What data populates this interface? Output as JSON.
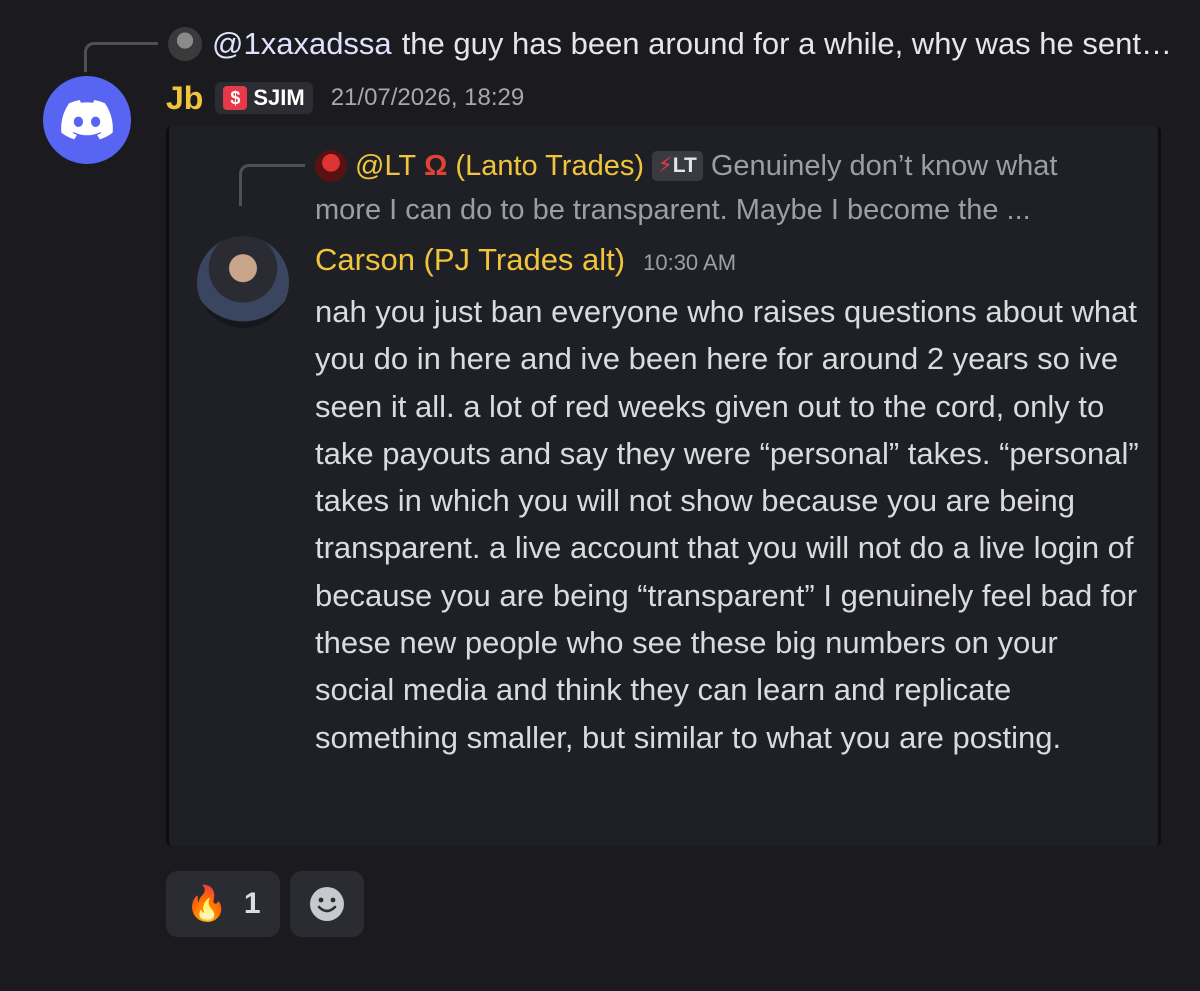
{
  "reply": {
    "mention": "@1xaxadssa",
    "text": "the guy has been around for a while, why was he sent to g..."
  },
  "message": {
    "author": "Jb",
    "role_tag": "SJIM",
    "timestamp": "21/07/2026, 18:29"
  },
  "embed": {
    "reply_mention": "@LT",
    "reply_name": "(Lanto Trades)",
    "reply_tag": "LT",
    "reply_line1": "Genuinely don’t know what",
    "reply_line2": "more I can do to be transparent.  Maybe I become the ...",
    "author": "Carson (PJ Trades alt)",
    "time": "10:30 AM",
    "body": "nah you just ban everyone who raises questions about what you do in here and ive been here for around 2 years so ive seen it all. a lot of red weeks given out to the cord, only to take payouts and say they were “personal” takes. “personal” takes in which you will not show because you are being transparent. a live account that you will not do a live login of because you are being “transparent” I genuinely feel bad for these new people who see these big numbers on your social media and think they can learn and replicate something smaller, but similar to what you are posting."
  },
  "reactions": [
    {
      "emoji": "🔥",
      "count": "1"
    }
  ],
  "colors": {
    "background": "#1b1b1f",
    "author": "#f0c43b",
    "discord_blurple": "#5865f2"
  }
}
